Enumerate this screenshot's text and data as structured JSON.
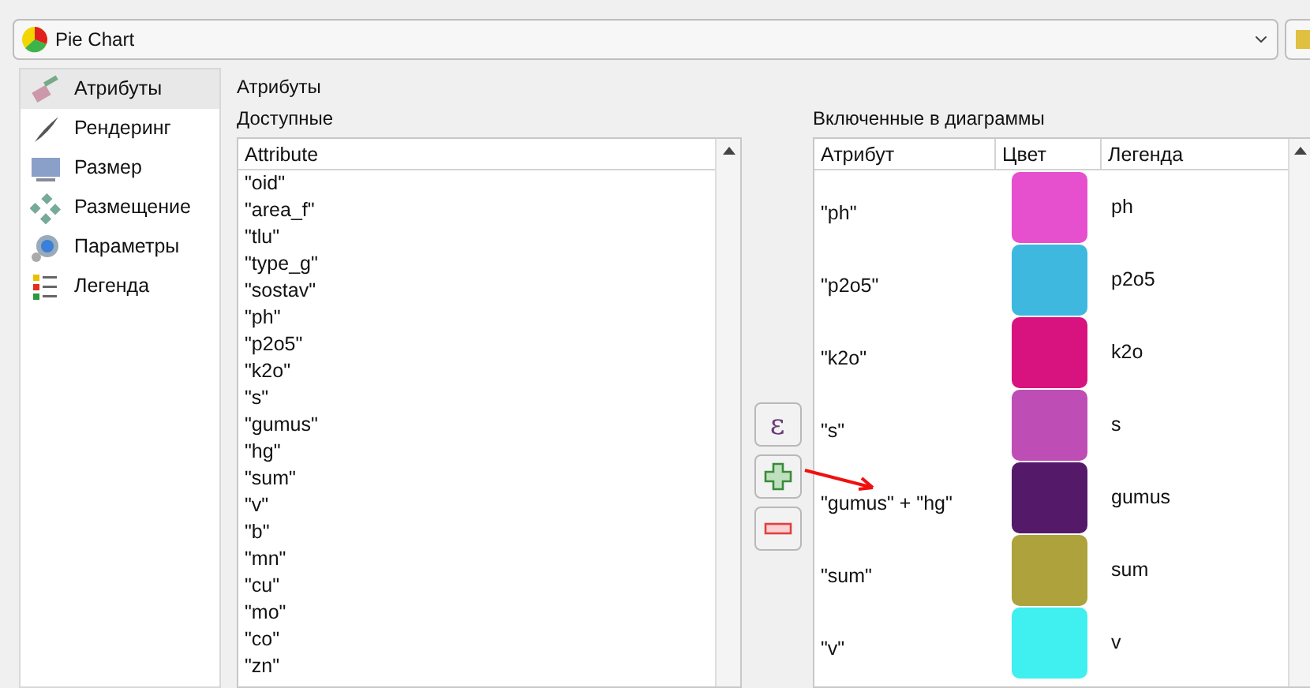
{
  "diagram_type": {
    "value": "Pie Chart"
  },
  "sidebar": {
    "items": [
      {
        "label": "Атрибуты",
        "selected": true
      },
      {
        "label": "Рендеринг",
        "selected": false
      },
      {
        "label": "Размер",
        "selected": false
      },
      {
        "label": "Размещение",
        "selected": false
      },
      {
        "label": "Параметры",
        "selected": false
      },
      {
        "label": "Легенда",
        "selected": false
      }
    ]
  },
  "section_title": "Атрибуты",
  "available": {
    "label": "Доступные",
    "column": "Attribute",
    "items": [
      "\"oid\"",
      "\"area_f\"",
      "\"tlu\"",
      "\"type_g\"",
      "\"sostav\"",
      "\"ph\"",
      "\"p2o5\"",
      "\"k2o\"",
      "\"s\"",
      "\"gumus\"",
      "\"hg\"",
      "\"sum\"",
      "\"v\"",
      "\"b\"",
      "\"mn\"",
      "\"cu\"",
      "\"mo\"",
      "\"co\"",
      "\"zn\""
    ]
  },
  "buttons": [
    {
      "kind": "expression",
      "label": "ε"
    },
    {
      "kind": "add"
    },
    {
      "kind": "remove"
    }
  ],
  "included": {
    "label": "Включенные в диаграммы",
    "columns": [
      "Атрибут",
      "Цвет",
      "Легенда"
    ],
    "rows": [
      {
        "attribute": "\"ph\"",
        "color": "#e64fce",
        "legend": "ph"
      },
      {
        "attribute": "\"p2o5\"",
        "color": "#3fb8e0",
        "legend": "p2o5"
      },
      {
        "attribute": "\"k2o\"",
        "color": "#d8137f",
        "legend": "k2o"
      },
      {
        "attribute": "\"s\"",
        "color": "#be4db5",
        "legend": "s"
      },
      {
        "attribute": "\"gumus\" + \"hg\"",
        "color": "#541a69",
        "legend": "gumus"
      },
      {
        "attribute": "\"sum\"",
        "color": "#ada23c",
        "legend": "sum"
      },
      {
        "attribute": "\"v\"",
        "color": "#40efef",
        "legend": "v"
      }
    ]
  }
}
